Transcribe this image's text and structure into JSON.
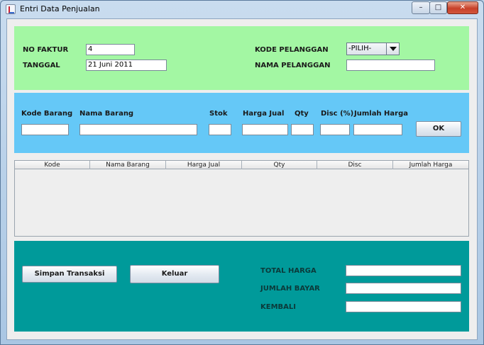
{
  "window": {
    "title": "Entri Data Penjualan",
    "controls": {
      "minimize": "–",
      "maximize": "□",
      "close": "✕"
    }
  },
  "header": {
    "no_faktur_label": "NO FAKTUR",
    "no_faktur_value": "4",
    "tanggal_label": "TANGGAL",
    "tanggal_value": "21 Juni 2011",
    "kode_pelanggan_label": "KODE PELANGGAN",
    "kode_pelanggan_selected": "-PILIH-",
    "nama_pelanggan_label": "NAMA PELANGGAN",
    "nama_pelanggan_value": ""
  },
  "item_entry": {
    "kode_barang_label": "Kode Barang",
    "nama_barang_label": "Nama Barang",
    "stok_label": "Stok",
    "harga_jual_label": "Harga Jual",
    "qty_label": "Qty",
    "disc_label": "Disc (%)",
    "jumlah_harga_label": "Jumlah Harga",
    "ok_label": "OK"
  },
  "table": {
    "columns": [
      "Kode",
      "Nama Barang",
      "Harga Jual",
      "Qty",
      "Disc",
      "Jumlah Harga"
    ],
    "rows": []
  },
  "footer": {
    "simpan_label": "Simpan Transaksi",
    "keluar_label": "Keluar",
    "total_harga_label": "TOTAL HARGA",
    "jumlah_bayar_label": "JUMLAH BAYAR",
    "kembali_label": "KEMBALI"
  },
  "colors": {
    "header_panel": "#a3f7a3",
    "entry_panel": "#65c8f7",
    "footer_panel": "#009a9a"
  },
  "icons": {
    "app": "java-app-icon",
    "dropdown": "chevron-down-icon"
  }
}
